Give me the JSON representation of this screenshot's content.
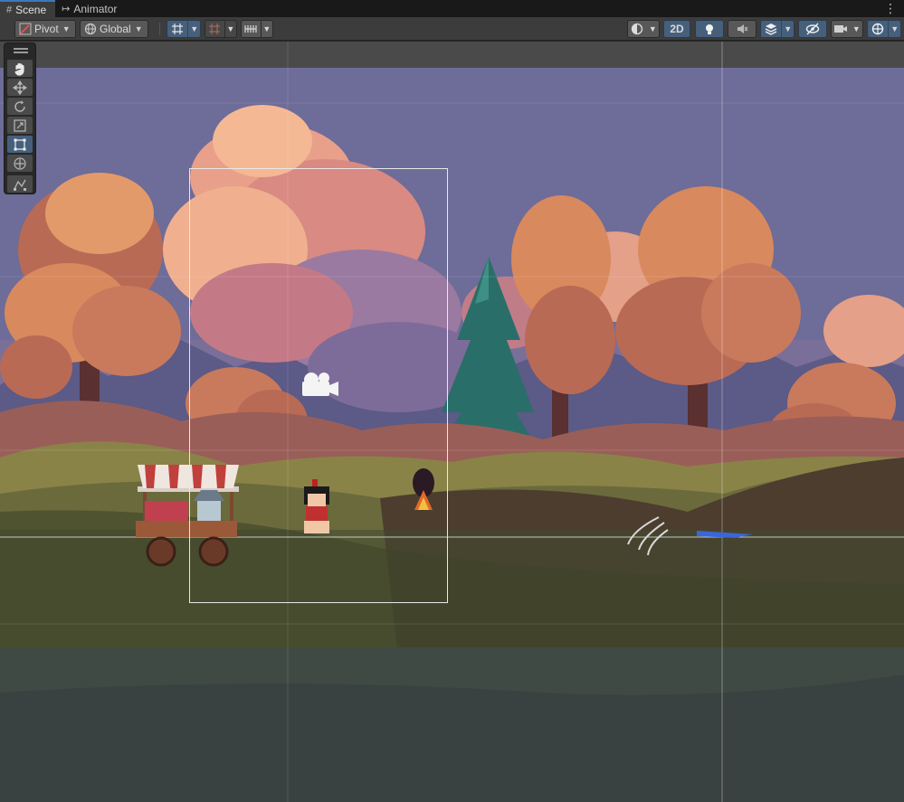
{
  "tabs": [
    {
      "label": "Scene",
      "icon": "grid-icon",
      "active": true
    },
    {
      "label": "Animator",
      "icon": "animator-icon",
      "active": false
    }
  ],
  "toolbar": {
    "pivot": "Pivot",
    "global": "Global",
    "mode_2d": "2D"
  },
  "palette_tools": [
    "hand-tool",
    "move-tool",
    "rotate-tool",
    "scale-tool",
    "rect-tool",
    "transform-tool",
    "custom-editor-tool"
  ],
  "colors": {
    "accent": "#46607c",
    "sky": "#6e6c98",
    "tree_orange": "#d9895e",
    "pine": "#2a6e6a",
    "grass": "#6b6a3c"
  }
}
